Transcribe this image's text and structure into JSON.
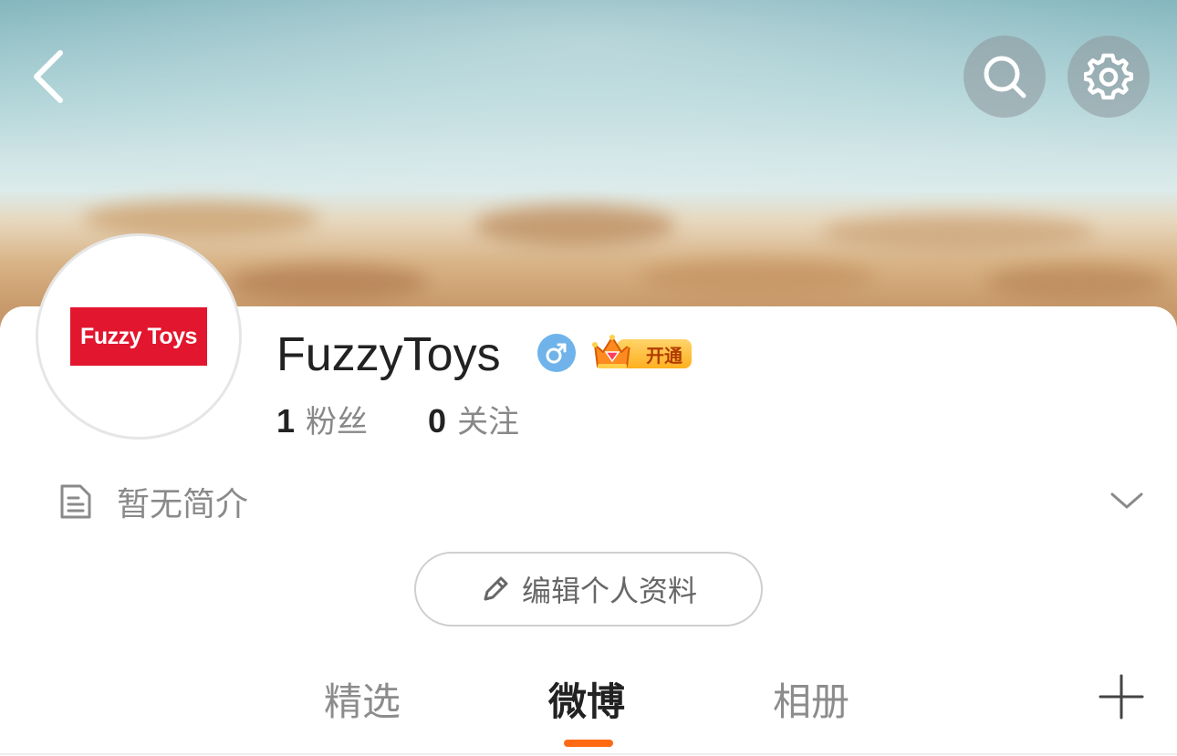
{
  "header": {
    "back_icon": "chevron-left-icon",
    "search_icon": "search-icon",
    "settings_icon": "gear-icon"
  },
  "profile": {
    "avatar_logo_text": "Fuzzy Toys",
    "username": "FuzzyToys",
    "gender_icon": "male-icon",
    "vip_badge_label": "开通",
    "followers_count": "1",
    "followers_label": "粉丝",
    "following_count": "0",
    "following_label": "关注",
    "bio_icon": "document-icon",
    "bio_text": "暂无简介",
    "bio_expand_icon": "chevron-down-icon",
    "edit_icon": "pencil-icon",
    "edit_button_label": "编辑个人资料"
  },
  "tabs": {
    "items": [
      {
        "label": "精选",
        "active": false
      },
      {
        "label": "微博",
        "active": true
      },
      {
        "label": "相册",
        "active": false
      }
    ],
    "add_icon": "plus-icon"
  },
  "colors": {
    "accent": "#ff6a13",
    "logo_red": "#e2162e",
    "gender_blue": "#6fb3ea",
    "vip_gold": "#ffb020"
  }
}
